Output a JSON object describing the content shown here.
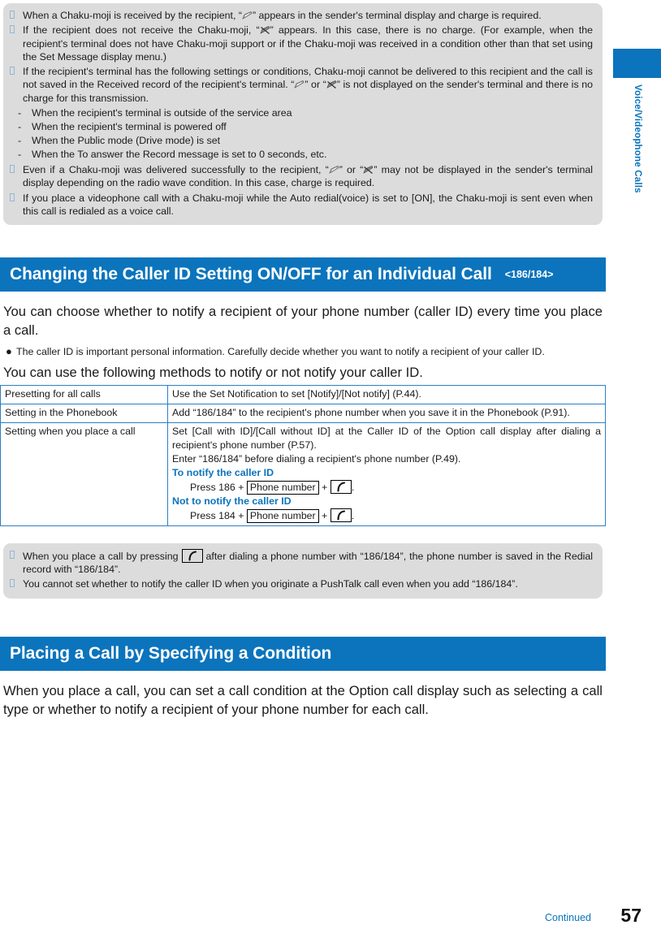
{
  "sidebar": {
    "tab_label": "Voice/Videophone Calls"
  },
  "notes_top": {
    "items": [
      {
        "pre": "When a Chaku-moji is received by the recipient, “",
        "icon": "chaku-moji-delivered-icon",
        "post": "” appears in the sender's terminal display and charge is required."
      },
      {
        "pre": "If the recipient does not receive the Chaku-moji, “",
        "icon": "chaku-moji-undelivered-icon",
        "post": "” appears. In this case, there is no charge. (For example, when the recipient's terminal does not have Chaku-moji support or if the Chaku-moji was received in a condition other than that set using the Set Message display menu.)"
      },
      {
        "pre": "If the recipient's terminal has the following settings or conditions, Chaku-moji cannot be delivered to this recipient and the call is not saved in the Received record of the recipient's terminal. “",
        "icon": "chaku-moji-delivered-icon",
        "mid": "” or “",
        "icon2": "chaku-moji-undelivered-icon",
        "post": "” is not displayed on the sender's terminal and there is no charge for this transmission.",
        "sublist": [
          "When the recipient's terminal is outside of the service area",
          "When the recipient's terminal is powered off",
          "When the Public mode (Drive mode) is set",
          "When the To answer the Record message is set to 0 seconds, etc."
        ]
      },
      {
        "pre": "Even if a Chaku-moji was delivered successfully to the recipient, “",
        "icon": "chaku-moji-delivered-icon",
        "mid": "” or “",
        "icon2": "chaku-moji-undelivered-icon",
        "post": "” may not be displayed in the sender's terminal display depending on the radio wave condition. In this case, charge is required."
      },
      {
        "pre": "If you place a videophone call with a Chaku-moji while the Auto redial(voice) is set to [ON], the Chaku-moji is sent even when this call is redialed as a voice call.",
        "post": ""
      }
    ]
  },
  "section1": {
    "title": "Changing the Caller ID Setting ON/OFF for an Individual Call",
    "badge": "<186/184>",
    "intro": "You can choose whether to notify a recipient of your phone number (caller ID) every time you place a call.",
    "caution": "The caller ID is important personal information. Carefully decide whether you want to notify a recipient of your caller ID.",
    "methods_intro": "You can use the following methods to notify or not notify your caller ID.",
    "table": {
      "rows": [
        {
          "label": "Presetting for all calls",
          "lines": [
            "Use the Set Notification to set [Notify]/[Not notify] (P.44)."
          ]
        },
        {
          "label": "Setting in the Phonebook",
          "lines": [
            "Add “186/184” to the recipient's phone number when you save it in the Phonebook (P.91)."
          ]
        },
        {
          "label": "Setting when you place a call",
          "lines": [
            "Set [Call with ID]/[Call without ID] at the Caller ID of the Option call display after dialing a recipient's phone number (P.57).",
            "Enter “186/184” before dialing a recipient's phone number (P.49)."
          ],
          "notify_heading": "To notify the caller ID",
          "notify_press_pre": "Press 186 + ",
          "notify_keybox": "Phone number",
          "notify_press_post": " + ",
          "notify_icon": "phone-call-key-icon",
          "notnotify_heading": "Not to notify the caller ID",
          "notnotify_press_pre": "Press 184 + ",
          "notnotify_keybox": "Phone number",
          "notnotify_press_post": " + ",
          "notnotify_icon": "phone-call-key-icon"
        }
      ]
    }
  },
  "notes_bottom": {
    "items": [
      {
        "pre": "When you place a call by pressing ",
        "icon": "phone-call-key-icon",
        "post": " after dialing a phone number with “186/184”, the phone number is saved in the Redial record with “186/184”."
      },
      {
        "pre": "You cannot set whether to notify the caller ID when you originate a PushTalk call even when you add “186/184”.",
        "post": ""
      }
    ]
  },
  "section2": {
    "title": "Placing a Call by Specifying a Condition",
    "body": "When you place a call, you can set a call condition at the Option call display such as selecting a call type or whether to notify a recipient of your phone number for each call."
  },
  "footer": {
    "continued": "Continued",
    "page_number": "57"
  },
  "colors": {
    "accent_blue": "#0b74bc",
    "note_bg": "#dcdcdc",
    "table_border": "#2e7fc0"
  }
}
